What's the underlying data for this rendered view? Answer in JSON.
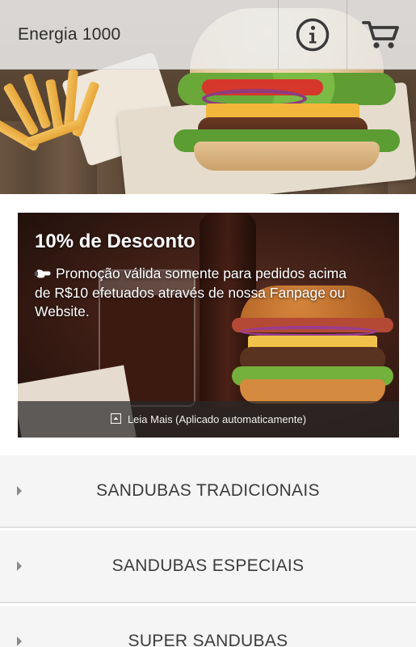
{
  "app_bar": {
    "title": "Energia 1000",
    "info_icon": "info-icon",
    "cart_icon": "cart-icon"
  },
  "hero": {
    "image": "burger-and-fries-photo"
  },
  "promo": {
    "title": "10% de Desconto",
    "description": "Promoção válida somente para pedidos acima de R$10 efetuados através de nossa Fanpage ou Website.",
    "description_icon": "pointing-hand-icon",
    "read_more": "Leia Mais (Aplicado automaticamente)",
    "read_more_icon": "expand-icon"
  },
  "categories": [
    {
      "label": "SANDUBAS TRADICIONAIS",
      "icon": "chevron-right-icon"
    },
    {
      "label": "SANDUBAS ESPECIAIS",
      "icon": "chevron-right-icon"
    },
    {
      "label": "SUPER SANDUBAS",
      "icon": "chevron-right-icon"
    }
  ],
  "colors": {
    "app_bar_bg": "#ebebeb",
    "title_text": "#2d2d2d",
    "list_bg": "#f5f5f5",
    "list_text": "#3c3c3c",
    "promo_text": "#ffffff"
  }
}
